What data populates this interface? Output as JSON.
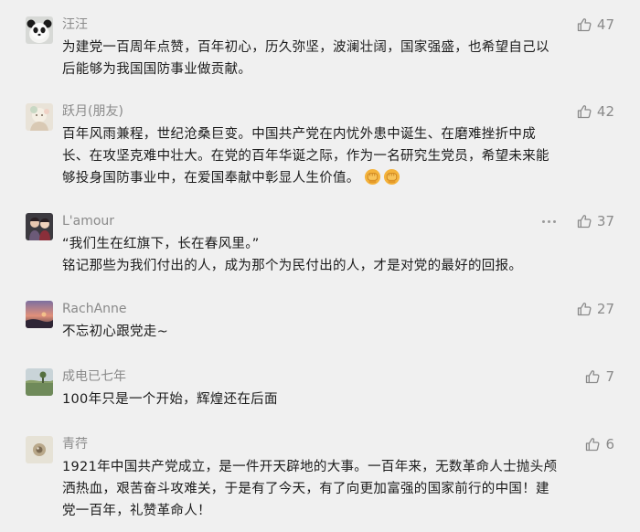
{
  "comments": [
    {
      "name": "汪汪",
      "likes": "47",
      "lines": [
        "为建党一百周年点赞，百年初心，历久弥坚，波澜壮阔，国家强盛，也希望自己以",
        "后能够为我国国防事业做贡献。"
      ]
    },
    {
      "name": "跃月(朋友)",
      "likes": "42",
      "lines": [
        "百年风雨兼程，世纪沧桑巨变。中国共产党在内忧外患中诞生、在磨难挫折中成",
        "长、在攻坚克难中壮大。在党的百年华诞之际，作为一名研究生党员，希望未来能",
        "够投身国防事业中，在爱国奉献中彰显人生价值。"
      ],
      "emoji": "fist-emoji"
    },
    {
      "name": "L'amour",
      "likes": "37",
      "lines": [
        "“我们生在红旗下，长在春风里。”",
        "铭记那些为我们付出的人，成为那个为民付出的人，才是对党的最好的回报。"
      ]
    },
    {
      "name": "RachAnne",
      "likes": "27",
      "lines": [
        "不忘初心跟党走~"
      ]
    },
    {
      "name": "成电已七年",
      "likes": "7",
      "lines": [
        "100年只是一个开始，辉煌还在后面"
      ]
    },
    {
      "name": "青荇",
      "likes": "6",
      "lines": [
        "1921年中国共产党成立，是一件开天辟地的大事。一百年来，无数革命人士抛头颅",
        "洒热血，艰苦奋斗攻难关，于是有了今天，有了向更加富强的国家前行的中国！建",
        "党一百年，礼赞革命人！"
      ]
    }
  ],
  "icons": {
    "like": "thumbs-up-icon",
    "more": "more-dots-icon"
  },
  "colors": {
    "background": "#f0f0f0",
    "name": "#8a8a8a",
    "text": "#1b1b1b",
    "like": "#8a8a8a"
  }
}
